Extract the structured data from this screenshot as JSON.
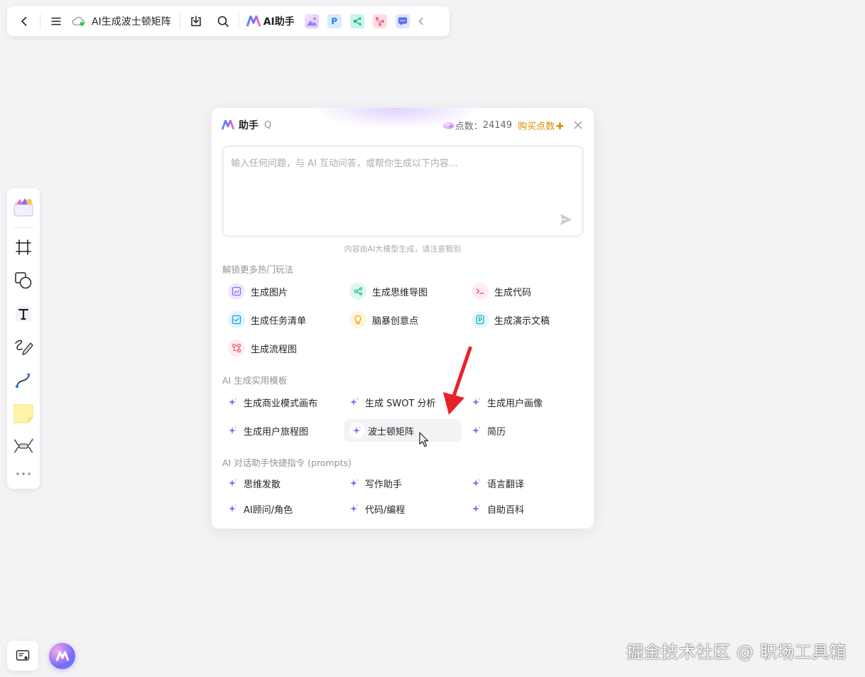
{
  "topbar": {
    "doc_title": "AI生成波士顿矩阵",
    "ai_label": "AI助手",
    "app_icons": [
      "image-gen-icon",
      "presentation-icon",
      "mindmap-icon",
      "flowchart-icon",
      "chat-icon"
    ]
  },
  "panel": {
    "title": "助手",
    "shortcut": "Q",
    "points_label": "点数：",
    "points_value": "24149",
    "buy_label": "购买点数",
    "input_placeholder": "输入任何问题，与 AI 互动问答，或帮你生成以下内容...",
    "disclaimer": "内容由AI大模型生成，请注意甄别",
    "sections": {
      "hot": {
        "title": "解锁更多热门玩法",
        "items": [
          "生成图片",
          "生成思维导图",
          "生成代码",
          "生成任务清单",
          "脑暴创意点",
          "生成演示文稿",
          "生成流程图"
        ]
      },
      "templates": {
        "title": "AI 生成实用模板",
        "items": [
          "生成商业模式画布",
          "生成 SWOT 分析",
          "生成用户画像",
          "生成用户旅程图",
          "波士顿矩阵",
          "简历"
        ]
      },
      "prompts": {
        "title": "AI 对话助手快捷指令 (prompts)",
        "items": [
          "思维发散",
          "写作助手",
          "语言翻译",
          "AI顾问/角色",
          "代码/编程",
          "自助百科"
        ]
      }
    }
  },
  "colors": {
    "accent_orange": "#e08a00",
    "spark_purple": "#8a6cf7",
    "annotation_red": "#e8212a"
  },
  "watermark": "掘金技术社区 @ 职场工具箱"
}
